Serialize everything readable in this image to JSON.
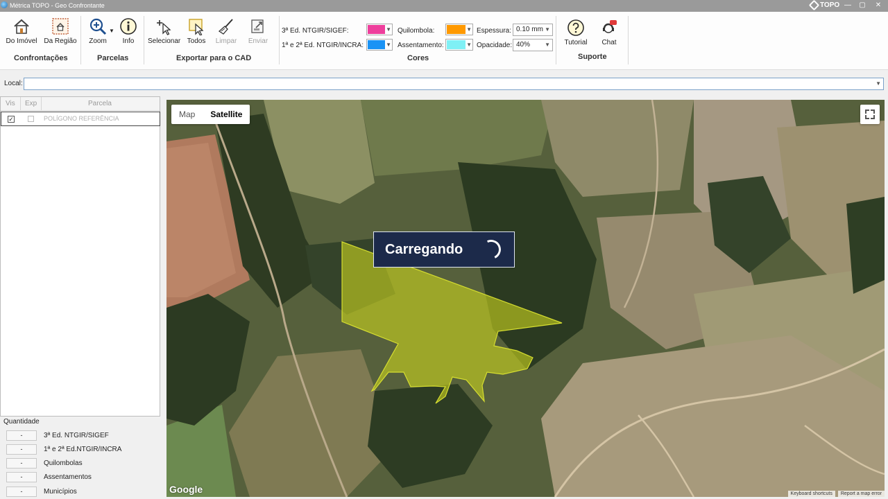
{
  "window": {
    "title": "Métrica TOPO - Geo Confrontante",
    "brand": "TOPO",
    "controls": [
      "—",
      "▢",
      "✕"
    ]
  },
  "ribbon": {
    "confrontacoes": {
      "title": "Confrontações",
      "do_imovel": "Do Imóvel",
      "da_regiao": "Da Região"
    },
    "parcelas": {
      "title": "Parcelas",
      "zoom": "Zoom",
      "info": "Info"
    },
    "exportar": {
      "title": "Exportar para o CAD",
      "selecionar": "Selecionar",
      "todos": "Todos",
      "limpar": "Limpar",
      "enviar": "Enviar"
    },
    "cores": {
      "title": "Cores",
      "sigef_label": "3ª Ed. NTGIR/SIGEF:",
      "sigef_color": "#ee3f9c",
      "incra_label": "1ª e 2ª Ed. NTGIR/INCRA:",
      "incra_color": "#1a93f5",
      "quilombola_label": "Quilombola:",
      "quilombola_color": "#ff9900",
      "assentamento_label": "Assentamento:",
      "assentamento_color": "#7ff0f5",
      "espessura_label": "Espessura:",
      "espessura_value": "0.10 mm",
      "opacidade_label": "Opacidade:",
      "opacidade_value": "40%"
    },
    "suporte": {
      "title": "Suporte",
      "tutorial": "Tutorial",
      "chat": "Chat"
    }
  },
  "local": {
    "label": "Local:",
    "value": ""
  },
  "parcel_list": {
    "headers": [
      "Vis",
      "Exp",
      "Parcela"
    ],
    "rows": [
      {
        "vis": true,
        "exp": false,
        "name": "POLÍGONO REFERÊNCIA"
      }
    ]
  },
  "quantidade": {
    "title": "Quantidade",
    "rows": [
      {
        "value": "-",
        "label": "3ª Ed. NTGIR/SIGEF"
      },
      {
        "value": "-",
        "label": "1ª e 2ª Ed.NTGIR/INCRA"
      },
      {
        "value": "-",
        "label": "Quilombolas"
      },
      {
        "value": "-",
        "label": "Assentamentos"
      },
      {
        "value": "-",
        "label": "Municípios"
      }
    ]
  },
  "map": {
    "type_map": "Map",
    "type_satellite": "Satellite",
    "selected_type": "Satellite",
    "loading_text": "Carregando",
    "google": "Google",
    "keyboard_shortcuts": "Keyboard shortcuts",
    "report_error": "Report a map error",
    "polygon_color": "#c8d21e"
  }
}
